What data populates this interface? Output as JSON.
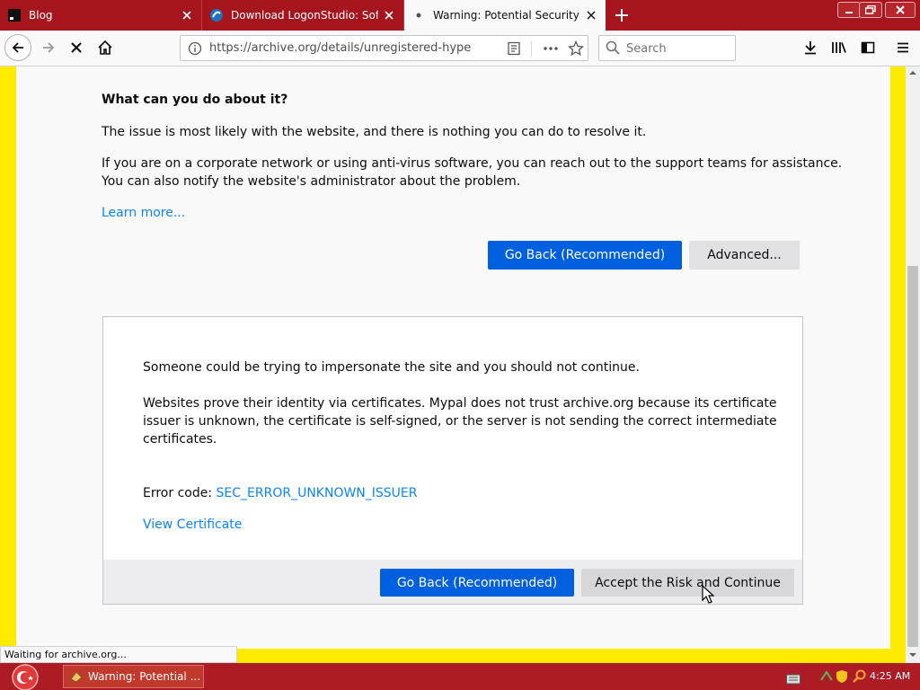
{
  "tabs": [
    {
      "label": "Blog",
      "icon": "blog-favicon-icon"
    },
    {
      "label": "Download LogonStudio: Softw",
      "icon": "download-site-favicon-icon"
    },
    {
      "label": "Warning: Potential Security Risk",
      "icon": "loading-dot-icon"
    }
  ],
  "toolbar": {
    "url": "https://archive.org/details/unregistered-hyperca",
    "search_placeholder": "Search"
  },
  "page": {
    "heading": "What can you do about it?",
    "para1": "The issue is most likely with the website, and there is nothing you can do to resolve it.",
    "para2_line1": "If you are on a corporate network or using anti-virus software, you can reach out to the support teams for assistance.",
    "para2_line2": "You can also notify the website's administrator about the problem.",
    "learn_more": "Learn more...",
    "go_back": "Go Back (Recommended)",
    "advanced": "Advanced..."
  },
  "advanced_panel": {
    "text1": "Someone could be trying to impersonate the site and you should not continue.",
    "text2_line1": "Websites prove their identity via certificates. Mypal does not trust archive.org because its certificate",
    "text2_line2": "issuer is unknown, the certificate is self-signed, or the server is not sending the correct intermediate",
    "text2_line3": "certificates.",
    "error_label": "Error code: ",
    "error_code": "SEC_ERROR_UNKNOWN_ISSUER",
    "view_certificate": "View Certificate",
    "go_back": "Go Back (Recommended)",
    "accept": "Accept the Risk and Continue"
  },
  "status": "Waiting for archive.org...",
  "taskbar": {
    "task_label": "Warning: Potential ...",
    "clock": "4:25 AM"
  },
  "colors": {
    "titlebar": "#a6151d",
    "page_border": "#ffeb00",
    "primary_button": "#0060df",
    "link": "#0a84ff",
    "taskbar": "#ad1c24"
  }
}
